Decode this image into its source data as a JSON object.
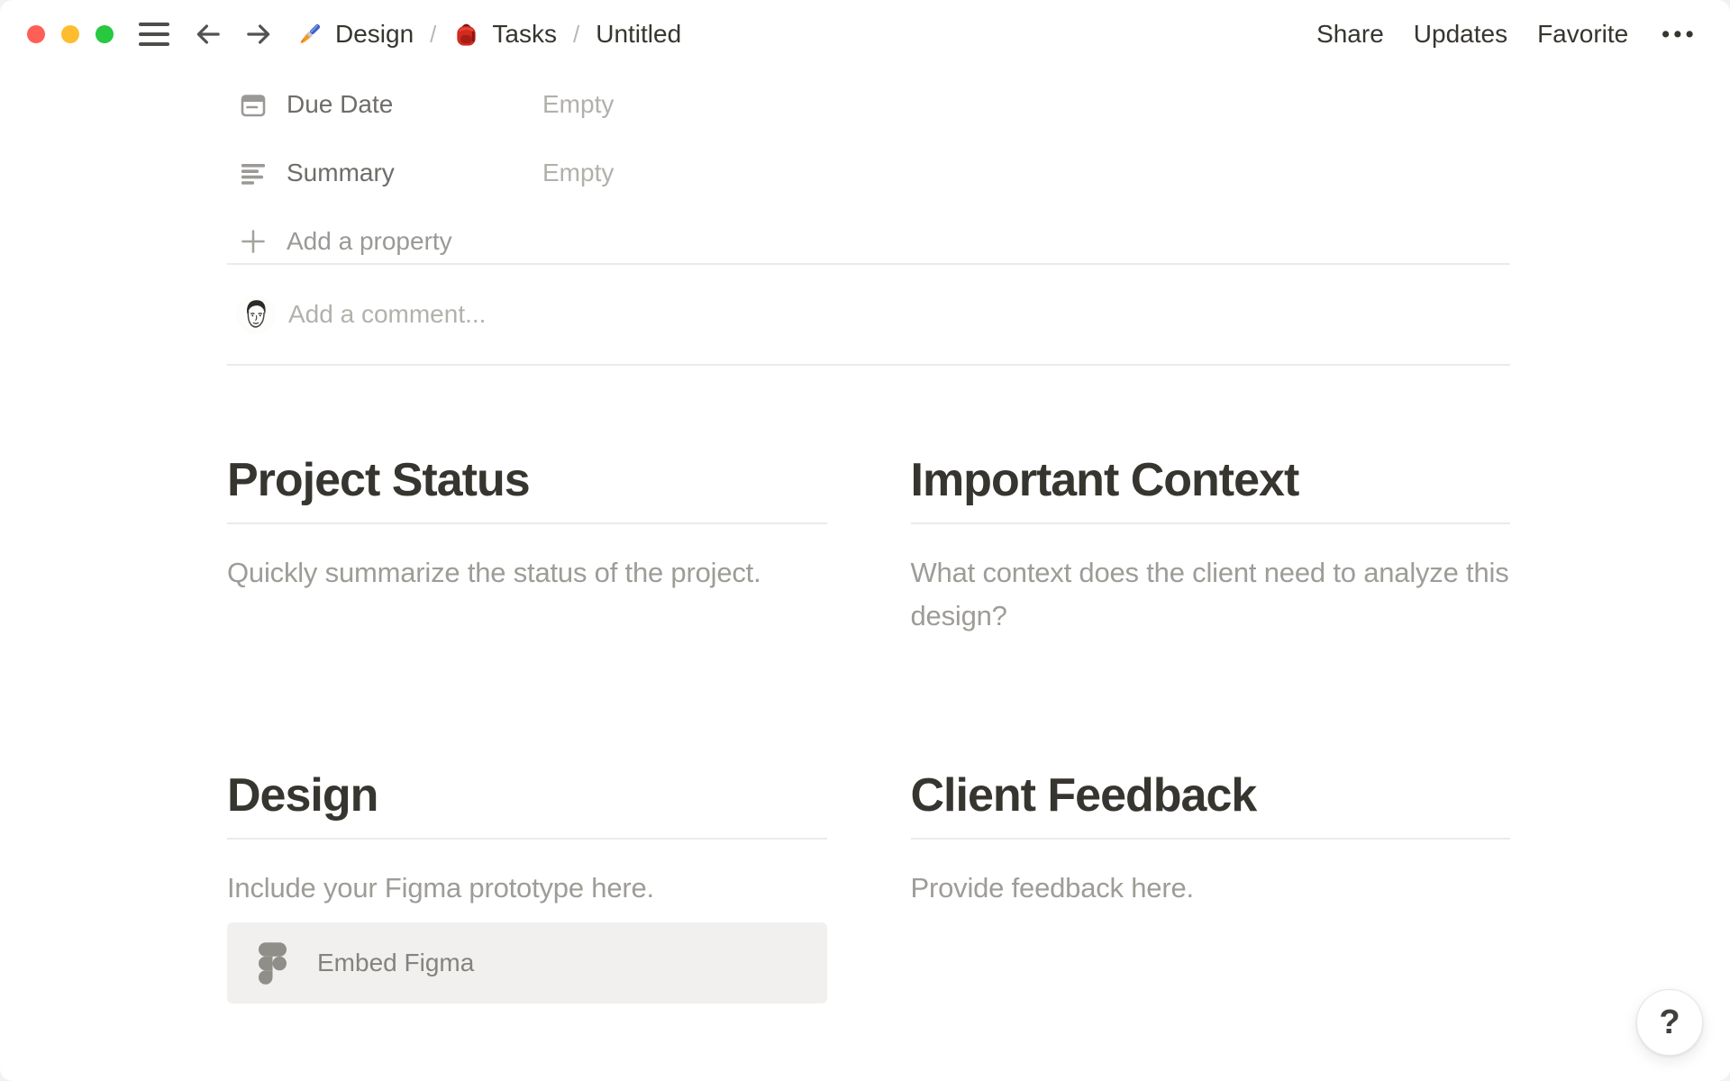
{
  "topbar": {
    "breadcrumb": {
      "separator": "/",
      "items": [
        {
          "icon": "paintbrush-icon",
          "label": "Design"
        },
        {
          "icon": "backpack-icon",
          "label": "Tasks"
        },
        {
          "icon": null,
          "label": "Untitled"
        }
      ]
    },
    "actions": {
      "share": "Share",
      "updates": "Updates",
      "favorite": "Favorite",
      "more": "•••"
    }
  },
  "properties": {
    "rows": [
      {
        "icon": "calendar-icon",
        "label": "Due Date",
        "value": "Empty"
      },
      {
        "icon": "text-lines-icon",
        "label": "Summary",
        "value": "Empty"
      }
    ],
    "add_property_label": "Add a property"
  },
  "comment": {
    "placeholder": "Add a comment..."
  },
  "sections": [
    {
      "title": "Project Status",
      "body": "Quickly summarize the status of the project."
    },
    {
      "title": "Important Context",
      "body": "What context does the client need to analyze this design?"
    },
    {
      "title": "Design",
      "body": "Include your Figma prototype here.",
      "embed_label": "Embed Figma"
    },
    {
      "title": "Client Feedback",
      "body": "Provide feedback here."
    }
  ],
  "help_button": {
    "label": "?"
  },
  "colors": {
    "text_primary": "#37352f",
    "text_secondary": "#6f6d69",
    "text_placeholder": "#b2b0ab",
    "text_instructional": "#9e9c97",
    "divider": "#eceae8",
    "embed_background": "#f1f0ee",
    "traffic_red": "#ff5f57",
    "traffic_yellow": "#febc2e",
    "traffic_green": "#28c840"
  }
}
